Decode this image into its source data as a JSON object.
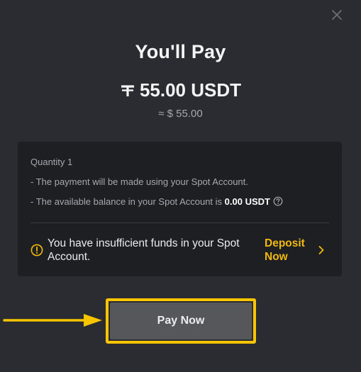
{
  "dialog": {
    "title": "You'll Pay",
    "currency_icon": "tether-icon",
    "amount": "55.00 USDT",
    "approx_value": "≈ $ 55.00"
  },
  "details": {
    "quantity": "Quantity 1",
    "payment_note": "- The payment will be made using your Spot Account.",
    "balance_prefix": "- The available balance in your Spot Account is ",
    "balance_value": "0.00 USDT"
  },
  "warning": {
    "message": "You have insufficient funds in your Spot Account.",
    "action_label": "Deposit Now"
  },
  "footer": {
    "pay_label": "Pay Now"
  },
  "colors": {
    "accent": "#f0b90b",
    "highlight": "#f8c500",
    "background": "#2b2c31",
    "card": "#1e1f23",
    "button": "#56575b"
  }
}
